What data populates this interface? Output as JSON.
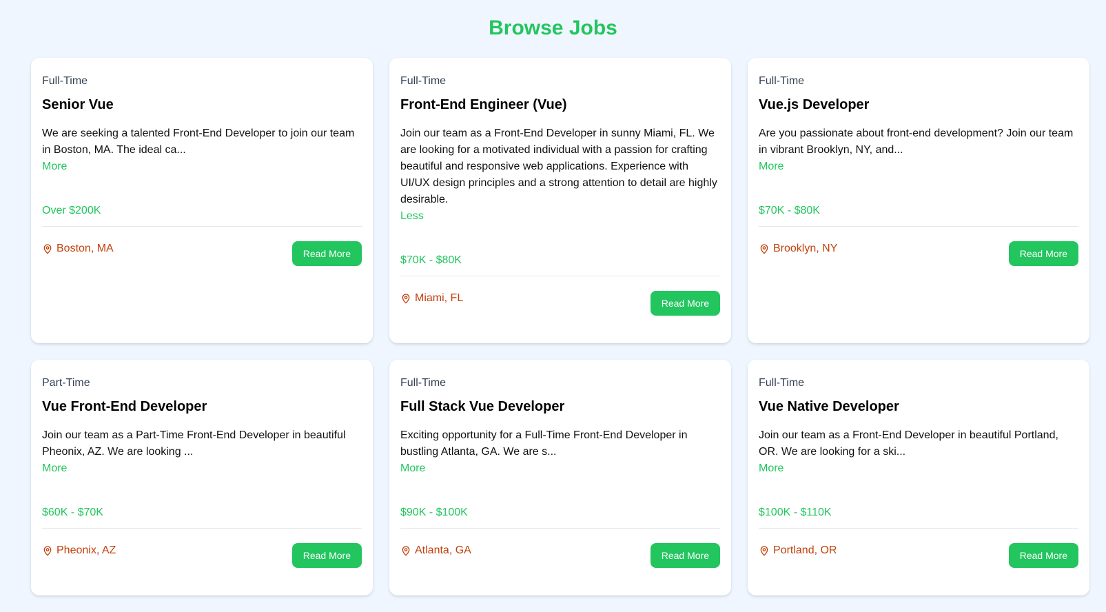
{
  "page": {
    "title": "Browse Jobs"
  },
  "colors": {
    "accent": "#22c55e",
    "location": "#c2410c",
    "background": "#eff6ff"
  },
  "icons": {
    "location": "map-pin-icon"
  },
  "jobs": [
    {
      "type": "Full-Time",
      "title": "Senior Vue",
      "description": "We are seeking a talented Front-End Developer to join our team in Boston, MA. The ideal ca...",
      "toggle": "More",
      "salary": "Over $200K",
      "location": "Boston, MA",
      "button": "Read More"
    },
    {
      "type": "Full-Time",
      "title": "Front-End Engineer (Vue)",
      "description": "Join our team as a Front-End Developer in sunny Miami, FL. We are looking for a motivated individual with a passion for crafting beautiful and responsive web applications. Experience with UI/UX design principles and a strong attention to detail are highly desirable.",
      "toggle": "Less",
      "salary": "$70K - $80K",
      "location": "Miami, FL",
      "button": "Read More"
    },
    {
      "type": "Full-Time",
      "title": "Vue.js Developer",
      "description": "Are you passionate about front-end development? Join our team in vibrant Brooklyn, NY, and...",
      "toggle": "More",
      "salary": "$70K - $80K",
      "location": "Brooklyn, NY",
      "button": "Read More"
    },
    {
      "type": "Part-Time",
      "title": "Vue Front-End Developer",
      "description": "Join our team as a Part-Time Front-End Developer in beautiful Pheonix, AZ. We are looking ...",
      "toggle": "More",
      "salary": "$60K - $70K",
      "location": "Pheonix, AZ",
      "button": "Read More"
    },
    {
      "type": "Full-Time",
      "title": "Full Stack Vue Developer",
      "description": "Exciting opportunity for a Full-Time Front-End Developer in bustling Atlanta, GA. We are s...",
      "toggle": "More",
      "salary": "$90K - $100K",
      "location": "Atlanta, GA",
      "button": "Read More"
    },
    {
      "type": "Full-Time",
      "title": "Vue Native Developer",
      "description": "Join our team as a Front-End Developer in beautiful Portland, OR. We are looking for a ski...",
      "toggle": "More",
      "salary": "$100K - $110K",
      "location": "Portland, OR",
      "button": "Read More"
    }
  ]
}
